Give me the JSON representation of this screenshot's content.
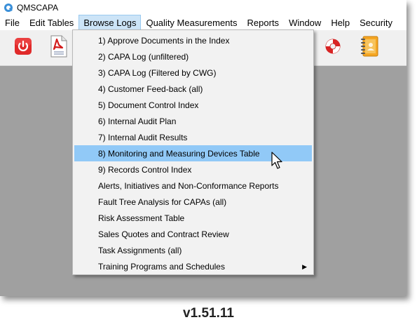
{
  "window": {
    "title": "QMSCAPA"
  },
  "menubar": {
    "items": [
      {
        "label": "File",
        "active": false
      },
      {
        "label": "Edit Tables",
        "active": false
      },
      {
        "label": "Browse Logs",
        "active": true
      },
      {
        "label": "Quality Measurements",
        "active": false
      },
      {
        "label": "Reports",
        "active": false
      },
      {
        "label": "Window",
        "active": false
      },
      {
        "label": "Help",
        "active": false
      },
      {
        "label": "Security",
        "active": false
      }
    ]
  },
  "toolbar": {
    "buttons": [
      {
        "icon": "power-icon"
      },
      {
        "icon": "document-pdf-icon"
      },
      {
        "icon": "lifebuoy-icon"
      },
      {
        "icon": "notebook-icon"
      }
    ]
  },
  "dropdown": {
    "items": [
      {
        "label": "1) Approve Documents in the Index",
        "highlighted": false,
        "submenu": false
      },
      {
        "label": "2) CAPA Log (unfiltered)",
        "highlighted": false,
        "submenu": false
      },
      {
        "label": "3) CAPA Log (Filtered by CWG)",
        "highlighted": false,
        "submenu": false
      },
      {
        "label": "4) Customer Feed-back (all)",
        "highlighted": false,
        "submenu": false
      },
      {
        "label": "5) Document Control Index",
        "highlighted": false,
        "submenu": false
      },
      {
        "label": "6) Internal Audit Plan",
        "highlighted": false,
        "submenu": false
      },
      {
        "label": "7) Internal Audit Results",
        "highlighted": false,
        "submenu": false
      },
      {
        "label": "8) Monitoring and Measuring Devices Table",
        "highlighted": true,
        "submenu": false
      },
      {
        "label": "9) Records Control Index",
        "highlighted": false,
        "submenu": false
      },
      {
        "label": "Alerts, Initiatives and Non-Conformance Reports",
        "highlighted": false,
        "submenu": false
      },
      {
        "label": "Fault Tree Analysis for CAPAs (all)",
        "highlighted": false,
        "submenu": false
      },
      {
        "label": "Risk Assessment Table",
        "highlighted": false,
        "submenu": false
      },
      {
        "label": "Sales Quotes and Contract Review",
        "highlighted": false,
        "submenu": false
      },
      {
        "label": "Task Assignments (all)",
        "highlighted": false,
        "submenu": false
      },
      {
        "label": "Training Programs and Schedules",
        "highlighted": false,
        "submenu": true
      }
    ]
  },
  "footer": {
    "version": "v1.51.11"
  },
  "colors": {
    "highlight": "#91c9f7",
    "active_menu": "#cce4f7",
    "workspace": "#a0a0a0"
  }
}
